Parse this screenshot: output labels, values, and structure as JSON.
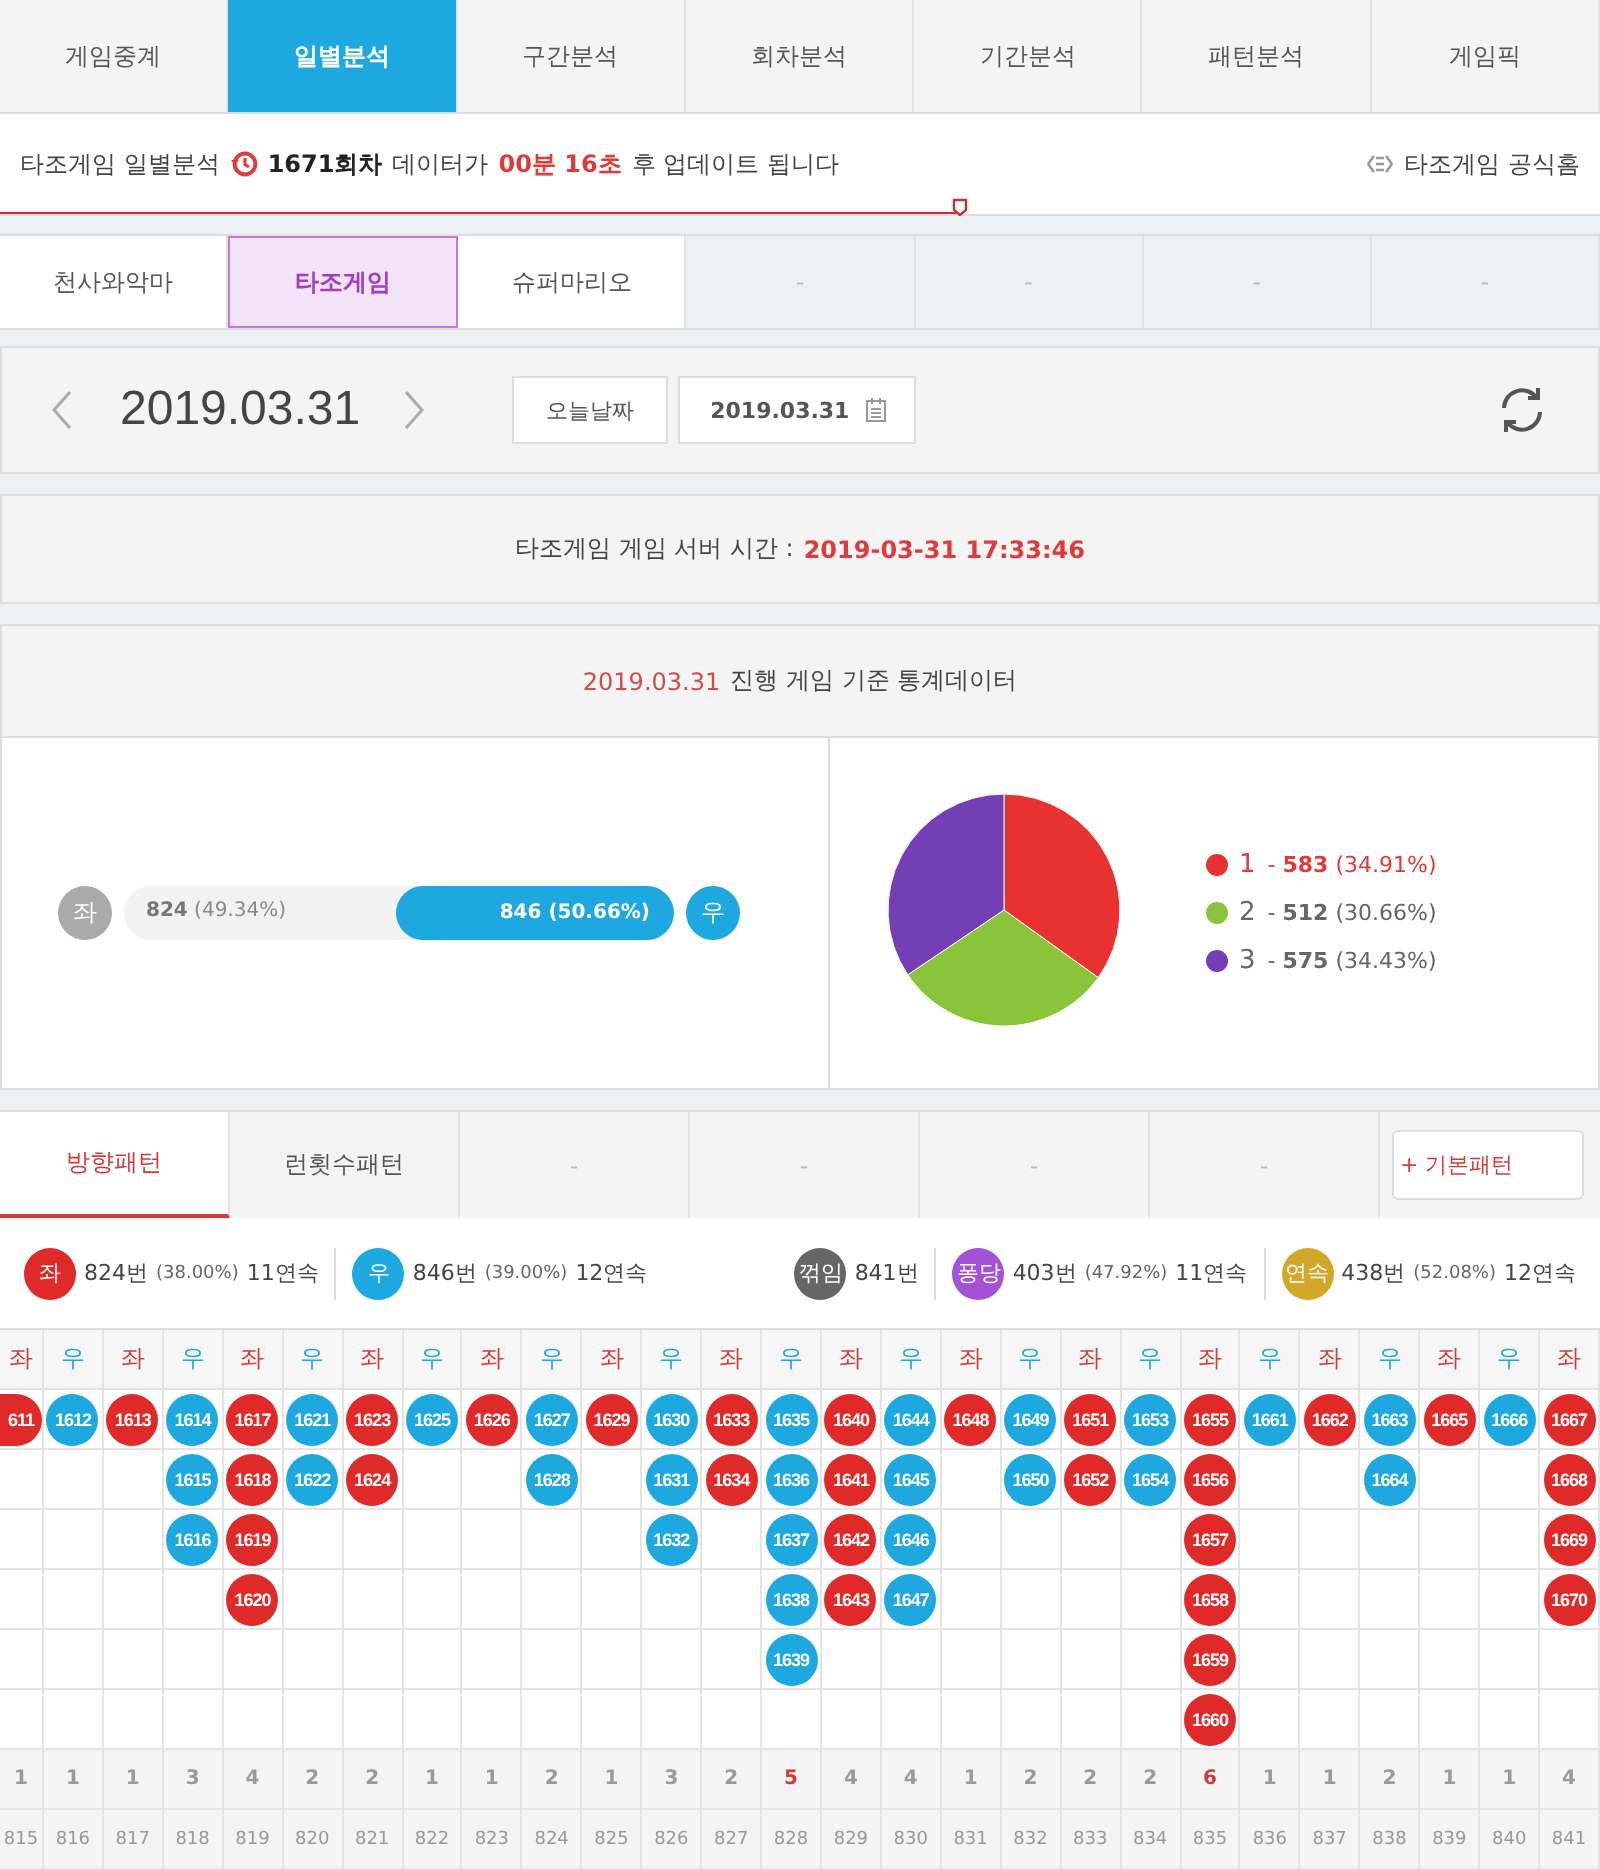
{
  "main_tabs": [
    {
      "label": "게임중계",
      "selected": false
    },
    {
      "label": "일별분석",
      "selected": true
    },
    {
      "label": "구간분석",
      "selected": false
    },
    {
      "label": "회차분석",
      "selected": false
    },
    {
      "label": "기간분석",
      "selected": false
    },
    {
      "label": "패턴분석",
      "selected": false
    },
    {
      "label": "게임픽",
      "selected": false
    }
  ],
  "update_bar": {
    "prefix": "타조게임 일별분석",
    "round": "1671회차",
    "middle": "데이터가",
    "countdown": "00분 16초",
    "suffix": "후 업데이트 됩니다",
    "link": "타조게임 공식홈",
    "progress": {
      "level": 0.6
    }
  },
  "game_tabs": [
    {
      "label": "천사와악마",
      "selected": false
    },
    {
      "label": "타조게임",
      "selected": true
    },
    {
      "label": "슈퍼마리오",
      "selected": false
    },
    {
      "label": "-",
      "selected": false
    },
    {
      "label": "-",
      "selected": false
    },
    {
      "label": "-",
      "selected": false
    },
    {
      "label": "-",
      "selected": false
    }
  ],
  "date_nav": {
    "date": "2019.03.31",
    "today_button": "오늘날짜",
    "date_field": "2019.03.31"
  },
  "server_time": {
    "label": "타조게임 게임 서버 시간 :",
    "value": "2019-03-31 17:33:46"
  },
  "stats": {
    "date": "2019.03.31",
    "title": "진행 게임 기준 통계데이터",
    "direction": {
      "left": {
        "badge": "좌",
        "text": "**824** (49.34%)",
        "selected": false
      },
      "right": {
        "badge": "우",
        "text": "846 (50.66%)",
        "selected": true
      },
      "level": 0.5066
    },
    "legend": [
      {
        "text": "- **583** (34.91%)",
        "color": "#e83232",
        "emphasis": true
      },
      {
        "text": "- **512** (30.66%)",
        "color": "#8ac43a",
        "emphasis": false
      },
      {
        "text": "- **575** (34.43%)",
        "color": "#743fb5",
        "emphasis": false
      }
    ],
    "chart_data": {
      "type": "pie",
      "categories": [
        "1",
        "2",
        "3"
      ],
      "series": [
        {
          "values": [
            34.91,
            30.66,
            34.43
          ]
        }
      ]
    }
  },
  "pattern_tabs": [
    {
      "label": "방향패턴",
      "selected": true
    },
    {
      "label": "런횟수패턴",
      "selected": false
    },
    {
      "label": "-",
      "selected": false
    },
    {
      "label": "-",
      "selected": false
    },
    {
      "label": "-",
      "selected": false
    },
    {
      "label": "-",
      "selected": false
    }
  ],
  "add_pattern_button": "+ 기본패턴",
  "summary_left": [
    {
      "badge": "좌",
      "color": "#e02a2a",
      "count": "824번",
      "percent": "(38.00%)",
      "streak": "11연속"
    },
    {
      "badge": "우",
      "color": "#1ea8e0",
      "count": "846번",
      "percent": "(39.00%)",
      "streak": "12연속"
    }
  ],
  "summary_right": [
    {
      "badge": "꺾임",
      "color": "#666666",
      "count": "841번"
    },
    {
      "badge": "퐁당",
      "color": "#a352d6",
      "count": "403번",
      "percent": "(47.92%)",
      "streak": "11연속"
    },
    {
      "badge": "연속",
      "color": "#d2a829",
      "count": "438번",
      "percent": "(52.08%)",
      "streak": "12연속"
    }
  ],
  "grid": [
    {
      "side": "좌",
      "kind": "left",
      "balls": [
        "611"
      ],
      "run": "1",
      "highlight": false,
      "round": "815"
    },
    {
      "side": "우",
      "kind": "right",
      "balls": [
        "1612"
      ],
      "run": "1",
      "highlight": false,
      "round": "816"
    },
    {
      "side": "좌",
      "kind": "left",
      "balls": [
        "1613"
      ],
      "run": "1",
      "highlight": false,
      "round": "817"
    },
    {
      "side": "우",
      "kind": "right",
      "balls": [
        "1614",
        "1615",
        "1616"
      ],
      "run": "3",
      "highlight": false,
      "round": "818"
    },
    {
      "side": "좌",
      "kind": "left",
      "balls": [
        "1617",
        "1618",
        "1619",
        "1620"
      ],
      "run": "4",
      "highlight": false,
      "round": "819"
    },
    {
      "side": "우",
      "kind": "right",
      "balls": [
        "1621",
        "1622"
      ],
      "run": "2",
      "highlight": false,
      "round": "820"
    },
    {
      "side": "좌",
      "kind": "left",
      "balls": [
        "1623",
        "1624"
      ],
      "run": "2",
      "highlight": false,
      "round": "821"
    },
    {
      "side": "우",
      "kind": "right",
      "balls": [
        "1625"
      ],
      "run": "1",
      "highlight": false,
      "round": "822"
    },
    {
      "side": "좌",
      "kind": "left",
      "balls": [
        "1626"
      ],
      "run": "1",
      "highlight": false,
      "round": "823"
    },
    {
      "side": "우",
      "kind": "right",
      "balls": [
        "1627",
        "1628"
      ],
      "run": "2",
      "highlight": false,
      "round": "824"
    },
    {
      "side": "좌",
      "kind": "left",
      "balls": [
        "1629"
      ],
      "run": "1",
      "highlight": false,
      "round": "825"
    },
    {
      "side": "우",
      "kind": "right",
      "balls": [
        "1630",
        "1631",
        "1632"
      ],
      "run": "3",
      "highlight": false,
      "round": "826"
    },
    {
      "side": "좌",
      "kind": "left",
      "balls": [
        "1633",
        "1634"
      ],
      "run": "2",
      "highlight": false,
      "round": "827"
    },
    {
      "side": "우",
      "kind": "right",
      "balls": [
        "1635",
        "1636",
        "1637",
        "1638",
        "1639"
      ],
      "run": "5",
      "highlight": true,
      "round": "828"
    },
    {
      "side": "좌",
      "kind": "left",
      "balls": [
        "1640",
        "1641",
        "1642",
        "1643"
      ],
      "run": "4",
      "highlight": false,
      "round": "829"
    },
    {
      "side": "우",
      "kind": "right",
      "balls": [
        "1644",
        "1645",
        "1646",
        "1647"
      ],
      "run": "4",
      "highlight": false,
      "round": "830"
    },
    {
      "side": "좌",
      "kind": "left",
      "balls": [
        "1648"
      ],
      "run": "1",
      "highlight": false,
      "round": "831"
    },
    {
      "side": "우",
      "kind": "right",
      "balls": [
        "1649",
        "1650"
      ],
      "run": "2",
      "highlight": false,
      "round": "832"
    },
    {
      "side": "좌",
      "kind": "left",
      "balls": [
        "1651",
        "1652"
      ],
      "run": "2",
      "highlight": false,
      "round": "833"
    },
    {
      "side": "우",
      "kind": "right",
      "balls": [
        "1653",
        "1654"
      ],
      "run": "2",
      "highlight": false,
      "round": "834"
    },
    {
      "side": "좌",
      "kind": "left",
      "balls": [
        "1655",
        "1656",
        "1657",
        "1658",
        "1659",
        "1660"
      ],
      "run": "6",
      "highlight": true,
      "round": "835"
    },
    {
      "side": "우",
      "kind": "right",
      "balls": [
        "1661"
      ],
      "run": "1",
      "highlight": false,
      "round": "836"
    },
    {
      "side": "좌",
      "kind": "left",
      "balls": [
        "1662"
      ],
      "run": "1",
      "highlight": false,
      "round": "837"
    },
    {
      "side": "우",
      "kind": "right",
      "balls": [
        "1663",
        "1664"
      ],
      "run": "2",
      "highlight": false,
      "round": "838"
    },
    {
      "side": "좌",
      "kind": "left",
      "balls": [
        "1665"
      ],
      "run": "1",
      "highlight": false,
      "round": "839"
    },
    {
      "side": "우",
      "kind": "right",
      "balls": [
        "1666"
      ],
      "run": "1",
      "highlight": false,
      "round": "840"
    },
    {
      "side": "좌",
      "kind": "left",
      "balls": [
        "1667",
        "1668",
        "1669",
        "1670"
      ],
      "run": "4",
      "highlight": false,
      "round": "841"
    }
  ]
}
